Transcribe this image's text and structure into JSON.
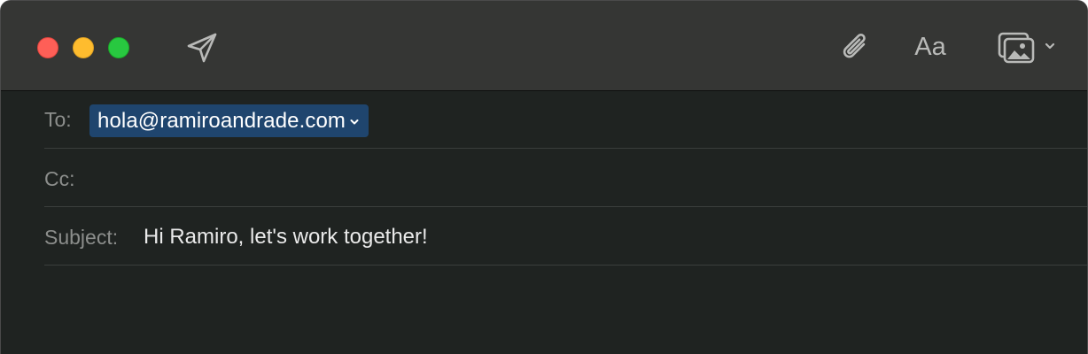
{
  "window": {
    "traffic_lights": [
      {
        "name": "close",
        "color": "#fe5f57"
      },
      {
        "name": "minimize",
        "color": "#febc2e"
      },
      {
        "name": "zoom",
        "color": "#28c840"
      }
    ]
  },
  "toolbar": {
    "send_icon": "paper-plane-icon",
    "attach_icon": "paperclip-icon",
    "format_label": "Aa",
    "photo_icon": "photo-browser-icon",
    "photo_menu_icon": "chevron-down-icon"
  },
  "fields": {
    "to": {
      "label": "To:",
      "recipient": "hola@ramiroandrade.com",
      "recipient_color": "#1f456e"
    },
    "cc": {
      "label": "Cc:",
      "value": ""
    },
    "subject": {
      "label": "Subject:",
      "value": "Hi Ramiro, let's work together!"
    }
  },
  "colors": {
    "toolbar_bg": "#353634",
    "content_bg": "#1f2321",
    "label_text": "#8c8e8c",
    "value_text": "#eaeaea"
  }
}
